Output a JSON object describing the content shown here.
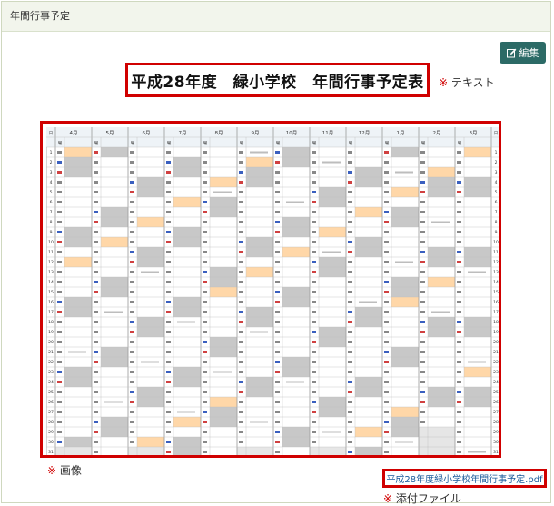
{
  "panel": {
    "header_title": "年間行事予定"
  },
  "toolbar": {
    "edit_label": "編集"
  },
  "content": {
    "title": "平成28年度　緑小学校　年間行事予定表",
    "text_note_mark": "※",
    "text_note": "テキスト",
    "image_note_mark": "※",
    "image_note": "画像",
    "file_note_mark": "※",
    "file_note": "添付ファイル",
    "attachment_name": "平成28年度緑小学校年間行事予定.pdf"
  },
  "calendar": {
    "day_header": "日",
    "weekday_header": "曜",
    "months": [
      "4月",
      "5月",
      "6月",
      "7月",
      "8月",
      "9月",
      "10月",
      "11月",
      "12月",
      "1月",
      "2月",
      "3月"
    ],
    "days": [
      "1",
      "2",
      "3",
      "4",
      "5",
      "6",
      "7",
      "8",
      "9",
      "10",
      "11",
      "12",
      "13",
      "14",
      "15",
      "16",
      "17",
      "18",
      "19",
      "20",
      "21",
      "22",
      "23",
      "24",
      "25",
      "26",
      "27",
      "28",
      "29",
      "30",
      "31"
    ],
    "colors": {
      "holiday": "#ffd7a8",
      "weekend": "#c8c8c8",
      "grid": "#9a9a9a",
      "header": "#eef3f7"
    }
  }
}
